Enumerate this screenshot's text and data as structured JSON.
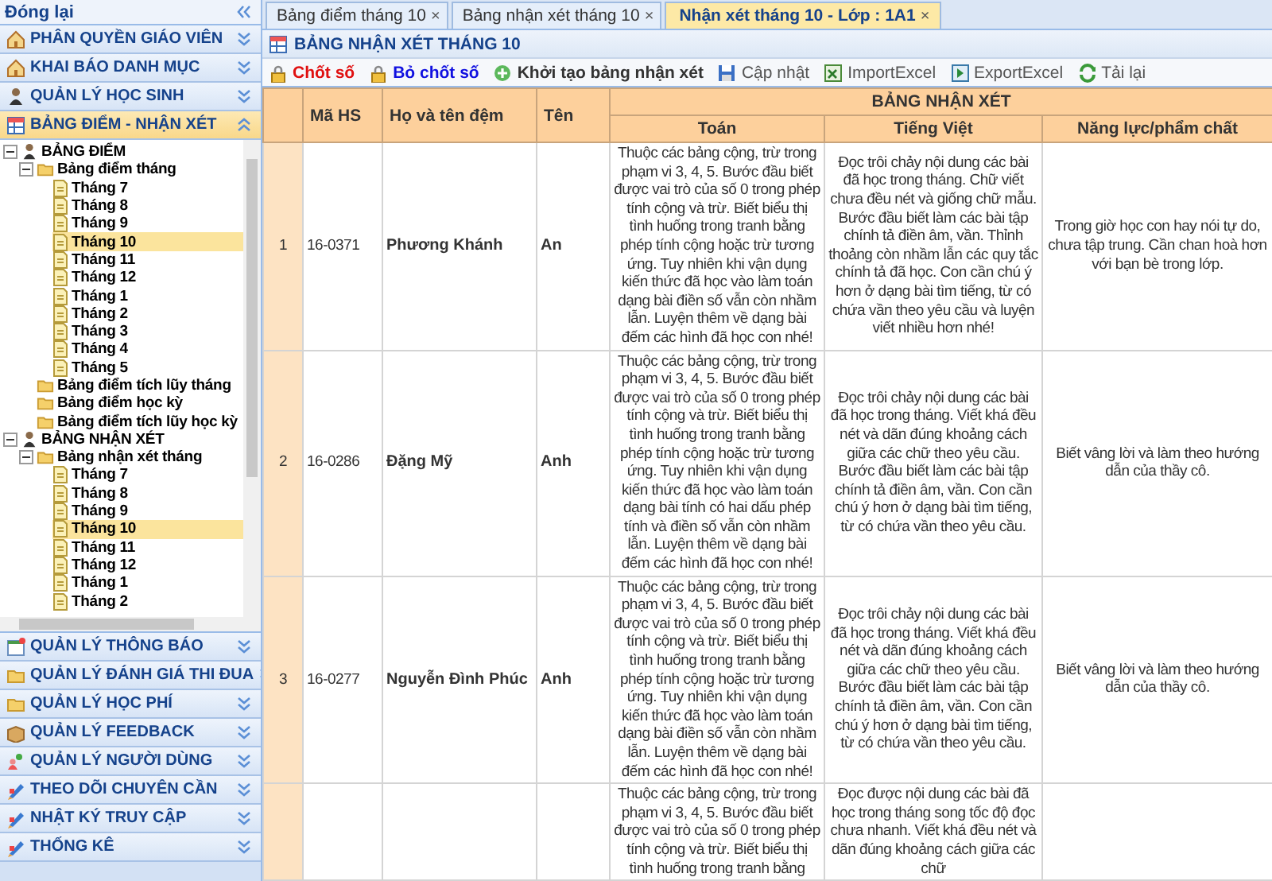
{
  "sidebar": {
    "collapse_label": "Đóng lại",
    "sections": [
      {
        "title": "PHÂN QUYỀN GIÁO VIÊN",
        "expanded": false
      },
      {
        "title": "KHAI BÁO DANH MỤC",
        "expanded": false
      },
      {
        "title": "QUẢN LÝ HỌC SINH",
        "expanded": false
      },
      {
        "title": "BẢNG ĐIỂM - NHẬN XÉT",
        "expanded": true,
        "tree": [
          {
            "label": "BẢNG ĐIỂM",
            "kind": "root",
            "selected": false,
            "children": [
              {
                "label": "Bảng điểm tháng",
                "kind": "folder",
                "selected": false,
                "children": [
                  {
                    "label": "Tháng 7",
                    "kind": "file",
                    "selected": false
                  },
                  {
                    "label": "Tháng 8",
                    "kind": "file",
                    "selected": false
                  },
                  {
                    "label": "Tháng 9",
                    "kind": "file",
                    "selected": false
                  },
                  {
                    "label": "Tháng 10",
                    "kind": "file",
                    "selected": true
                  },
                  {
                    "label": "Tháng 11",
                    "kind": "file",
                    "selected": false
                  },
                  {
                    "label": "Tháng 12",
                    "kind": "file",
                    "selected": false
                  },
                  {
                    "label": "Tháng 1",
                    "kind": "file",
                    "selected": false
                  },
                  {
                    "label": "Tháng 2",
                    "kind": "file",
                    "selected": false
                  },
                  {
                    "label": "Tháng 3",
                    "kind": "file",
                    "selected": false
                  },
                  {
                    "label": "Tháng 4",
                    "kind": "file",
                    "selected": false
                  },
                  {
                    "label": "Tháng 5",
                    "kind": "file",
                    "selected": false
                  }
                ]
              },
              {
                "label": "Bảng điểm tích lũy tháng",
                "kind": "folder",
                "selected": false
              },
              {
                "label": "Bảng điểm học kỳ",
                "kind": "folder",
                "selected": false
              },
              {
                "label": "Bảng điểm tích lũy học kỳ",
                "kind": "folder",
                "selected": false
              }
            ]
          },
          {
            "label": "BẢNG NHẬN XÉT",
            "kind": "root",
            "selected": false,
            "children": [
              {
                "label": "Bảng nhận xét tháng",
                "kind": "folder",
                "selected": false,
                "children": [
                  {
                    "label": "Tháng 7",
                    "kind": "file",
                    "selected": false
                  },
                  {
                    "label": "Tháng 8",
                    "kind": "file",
                    "selected": false
                  },
                  {
                    "label": "Tháng 9",
                    "kind": "file",
                    "selected": false
                  },
                  {
                    "label": "Tháng 10",
                    "kind": "file",
                    "selected": true
                  },
                  {
                    "label": "Tháng 11",
                    "kind": "file",
                    "selected": false
                  },
                  {
                    "label": "Tháng 12",
                    "kind": "file",
                    "selected": false
                  },
                  {
                    "label": "Tháng 1",
                    "kind": "file",
                    "selected": false
                  },
                  {
                    "label": "Tháng 2",
                    "kind": "file",
                    "selected": false
                  }
                ]
              }
            ]
          }
        ]
      },
      {
        "title": "QUẢN LÝ THÔNG BÁO",
        "expanded": false
      },
      {
        "title": "QUẢN LÝ ĐÁNH GIÁ THI ĐUA",
        "expanded": false
      },
      {
        "title": "QUẢN LÝ HỌC PHÍ",
        "expanded": false
      },
      {
        "title": "QUẢN LÝ FEEDBACK",
        "expanded": false
      },
      {
        "title": "QUẢN LÝ NGƯỜI DÙNG",
        "expanded": false
      },
      {
        "title": "THEO DÕI CHUYÊN CẦN",
        "expanded": false
      },
      {
        "title": "NHẬT KÝ TRUY CẬP",
        "expanded": false
      },
      {
        "title": "THỐNG KÊ",
        "expanded": false
      }
    ]
  },
  "tabs": [
    {
      "label": "Bảng điểm tháng 10",
      "close": "×",
      "selected": false
    },
    {
      "label": "Bảng nhận xét tháng 10",
      "close": "×",
      "selected": false
    },
    {
      "label": "Nhận xét tháng 10 - Lớp : 1A1",
      "close": "×",
      "selected": true
    }
  ],
  "panel_title": "BẢNG NHẬN XÉT THÁNG 10",
  "toolbar": [
    {
      "label": "Chốt số",
      "color": "#e01010",
      "bold": true
    },
    {
      "label": "Bỏ chốt số",
      "color": "#1010e0",
      "bold": true
    },
    {
      "label": "Khởi tạo bảng nhận xét",
      "color": "#333333",
      "bold": true
    },
    {
      "label": "Cập nhật",
      "color": "#555555",
      "bold": false
    },
    {
      "label": "ImportExcel",
      "color": "#555555",
      "bold": false
    },
    {
      "label": "ExportExcel",
      "color": "#555555",
      "bold": false
    },
    {
      "label": "Tải lại",
      "color": "#555555",
      "bold": false
    }
  ],
  "table": {
    "columns": [
      "Mã HS",
      "Họ và tên đệm",
      "Tên"
    ],
    "group": {
      "title": "BẢNG NHẬN XÉT",
      "columns": [
        "Toán",
        "Tiếng Việt",
        "Năng lực/phẩm chất"
      ]
    },
    "rows": [
      {
        "index": "1",
        "ma_hs": "16-0371",
        "ho_dem": "Phương Khánh",
        "ten": "An",
        "toan": "Thuộc các bảng cộng, trừ trong phạm vi 3, 4, 5. Bước đầu biết được vai trò của số 0 trong phép tính cộng và trừ. Biết biểu thị tình huống trong tranh bằng phép tính cộng hoặc trừ tương ứng. Tuy nhiên khi vận dụng kiến thức đã học vào làm toán dạng bài điền số vẫn còn nhầm lẫn. Luyện thêm về dạng bài đếm các hình đã học con nhé!",
        "tieng_viet": "Đọc trôi chảy nội dung các bài đã học trong tháng. Chữ viết chưa đều nét và giống chữ mẫu. Bước đầu biết làm các bài tập chính tả điền âm, vần. Thỉnh thoảng còn nhầm lẫn các quy tắc chính tả đã học. Con cần chú ý hơn ở dạng bài tìm tiếng, từ có chứa vần theo yêu cầu và luyện viết nhiều hơn nhé!",
        "nang_luc": "Trong giờ học con hay nói tự do, chưa tập trung. Cần chan hoà hơn với bạn bè trong lớp."
      },
      {
        "index": "2",
        "ma_hs": "16-0286",
        "ho_dem": "Đặng Mỹ",
        "ten": "Anh",
        "toan": "Thuộc các bảng cộng, trừ trong phạm vi 3, 4, 5. Bước đầu biết được vai trò của số 0 trong phép tính cộng và trừ. Biết biểu thị tình huống trong tranh bằng phép tính cộng hoặc trừ tương ứng. Tuy nhiên khi vận dụng kiến thức đã học vào làm toán dạng bài tính có hai dấu phép tính và điền số vẫn còn nhầm lẫn. Luyện thêm về dạng bài đếm các hình đã học con nhé!",
        "tieng_viet": "Đọc trôi chảy nội dung các bài đã học trong tháng. Viết khá đều nét và dãn đúng khoảng cách giữa các chữ theo yêu cầu. Bước đầu biết làm các bài tập chính tả điền âm, vần. Con cần chú ý hơn ở dạng bài tìm tiếng, từ có chứa vần theo yêu cầu.",
        "nang_luc": "Biết vâng lời và làm theo hướng dẫn của thầy cô."
      },
      {
        "index": "3",
        "ma_hs": "16-0277",
        "ho_dem": "Nguyễn Đình Phúc",
        "ten": "Anh",
        "toan": "Thuộc các bảng cộng, trừ trong phạm vi 3, 4, 5. Bước đầu biết được vai trò của số 0 trong phép tính cộng và trừ. Biết biểu thị tình huống trong tranh bằng phép tính cộng hoặc trừ tương ứng. Tuy nhiên khi vận dụng kiến thức đã học vào làm toán dạng bài điền số vẫn còn nhầm lẫn. Luyện thêm về dạng bài đếm các hình đã học con nhé!",
        "tieng_viet": "Đọc trôi chảy nội dung các bài đã học trong tháng. Viết khá đều nét và dãn đúng khoảng cách giữa các chữ theo yêu cầu. Bước đầu biết làm các bài tập chính tả điền âm, vần. Con cần chú ý hơn ở dạng bài tìm tiếng, từ có chứa vần theo yêu cầu.",
        "nang_luc": "Biết vâng lời và làm theo hướng dẫn của thầy cô."
      },
      {
        "toan": "Thuộc các bảng cộng, trừ trong phạm vi 3, 4, 5. Bước đầu biết được vai trò của số 0 trong phép tính cộng và trừ. Biết biểu thị tình huống trong tranh bằng",
        "tieng_viet": "Đọc được nội dung các bài đã học trong tháng song tốc độ đọc chưa nhanh. Viết khá đều nét và dãn đúng khoảng cách giữa các chữ"
      }
    ]
  }
}
